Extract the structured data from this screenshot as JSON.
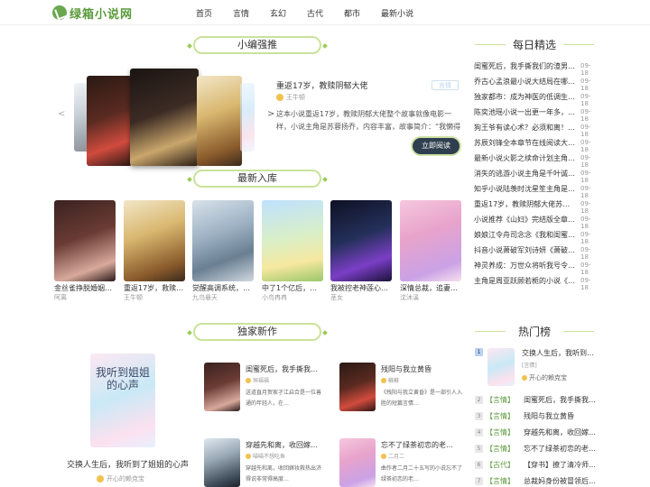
{
  "brand": {
    "logo_text": "绿箱小说网"
  },
  "nav": [
    "首页",
    "言情",
    "玄幻",
    "古代",
    "都市",
    "最新小说"
  ],
  "featured": {
    "title": "小编强推",
    "book_title": "重返17岁，教赎阴郁大佬",
    "author": "王牛顿",
    "badge": "言情",
    "description": "这本小说重返17岁，教赎阴郁大佬整个故事就像电影一样，小说主角是苏蓉扬乔，内容丰富，故事简介：“我懒得搭理他，伸手拽住…",
    "read_button": "立即阅读",
    "prev": "<",
    "next": ">"
  },
  "latest": {
    "title": "最新入库",
    "books": [
      {
        "title": "金丝雀挣脱婚姻…",
        "author": "阿离"
      },
      {
        "title": "重返17岁，救赎…",
        "author": "王牛顿"
      },
      {
        "title": "觉醒高调系统，…",
        "author": "九乌悬天"
      },
      {
        "title": "中了1个亿后，老…",
        "author": "小鸟冉冉"
      },
      {
        "title": "我被控老神莲心…",
        "author": "茎女"
      },
      {
        "title": "深情总裁，追妻…",
        "author": "沈沐溪"
      }
    ]
  },
  "exclusive": {
    "title": "独家新作",
    "main_book": {
      "title": "交换人生后，我听到了姐姐的心声",
      "author": "开心的赖克宝",
      "cover_text": "我听到姐姐的心声"
    },
    "items": [
      {
        "title": "闺蜜死后，我手撕我…",
        "author": "恒福福",
        "desc": "送道直月贺家孑江启合是一位善通的年轻人，在…"
      },
      {
        "title": "残阳与我立黄昏",
        "author": "蘇蘇",
        "desc": "《残阳与我立黄昏》是一部引人入胜的短篇言情…"
      },
      {
        "title": "穿越先和离，收回嫁…",
        "author": "喵喵不想吃鱼",
        "desc": "穿越先和离，收回嫁妆救热出济得说非常得高度…"
      },
      {
        "title": "忘不了绿茶初恋的老…",
        "author": "二月二",
        "desc": "曲作者二月二十五写的小说忘不了绿茶初恋的老…"
      }
    ]
  },
  "daily": {
    "title": "每日精选",
    "items": [
      {
        "title": "闺蜜死后，我手撕我们的渣男老…",
        "date": "09-18"
      },
      {
        "title": "乔古心孟浪最小说大结局在哪看…",
        "date": "09-18"
      },
      {
        "title": "独家都市：成为神医的低调生活…",
        "date": "09-18"
      },
      {
        "title": "陈奕池瑶小说一出更一年多，老…",
        "date": "09-18"
      },
      {
        "title": "狗王爷有读心术？必须和离！知…",
        "date": "09-18"
      },
      {
        "title": "苏辰刘锋全本章节在线阅读大结局",
        "date": "09-18"
      },
      {
        "title": "最新小说火影之续命计划主角牟…",
        "date": "09-18"
      },
      {
        "title": "消失的逃游小说主角是千叶诚李…",
        "date": "09-18"
      },
      {
        "title": "知乎小说陆羡时沈星笙主角是陆…",
        "date": "09-18"
      },
      {
        "title": "重返17岁，教赎阴郁大佬苏蓉扬…",
        "date": "09-18"
      },
      {
        "title": "小说推荐《山妇》完结版全章节…",
        "date": "09-18"
      },
      {
        "title": "娘娘江令舟司念念《我和闺蜜穿…",
        "date": "09-18"
      },
      {
        "title": "抖音小说萧破军刘诗妍《萧破军…",
        "date": "09-18"
      },
      {
        "title": "神灵养成：万世众将听我号令！…",
        "date": "09-18"
      },
      {
        "title": "主角是周亚跃顾若栀的小说《…",
        "date": "09-18"
      }
    ]
  },
  "hot": {
    "title": "热门榜",
    "first": {
      "rank": "1",
      "title": "交换人生后，我听到了…",
      "tag": "[言情]",
      "author": "开心的赖克宝"
    },
    "items": [
      {
        "rank": "2",
        "tag": "【言情】",
        "title": "闺蜜死后，我手撕我们的…"
      },
      {
        "rank": "3",
        "tag": "【言情】",
        "title": "残阳与我立黄昏"
      },
      {
        "rank": "4",
        "tag": "【言情】",
        "title": "穿越先和离，收回嫁妆救…"
      },
      {
        "rank": "5",
        "tag": "【言情】",
        "title": "忘不了绿茶初恋的老伴我…"
      },
      {
        "rank": "6",
        "tag": "【古代】",
        "title": "【穿书】撩了清冷师兄后…"
      },
      {
        "rank": "7",
        "tag": "【言情】",
        "title": "总裁妈身份被冒领后，儿…"
      }
    ]
  }
}
